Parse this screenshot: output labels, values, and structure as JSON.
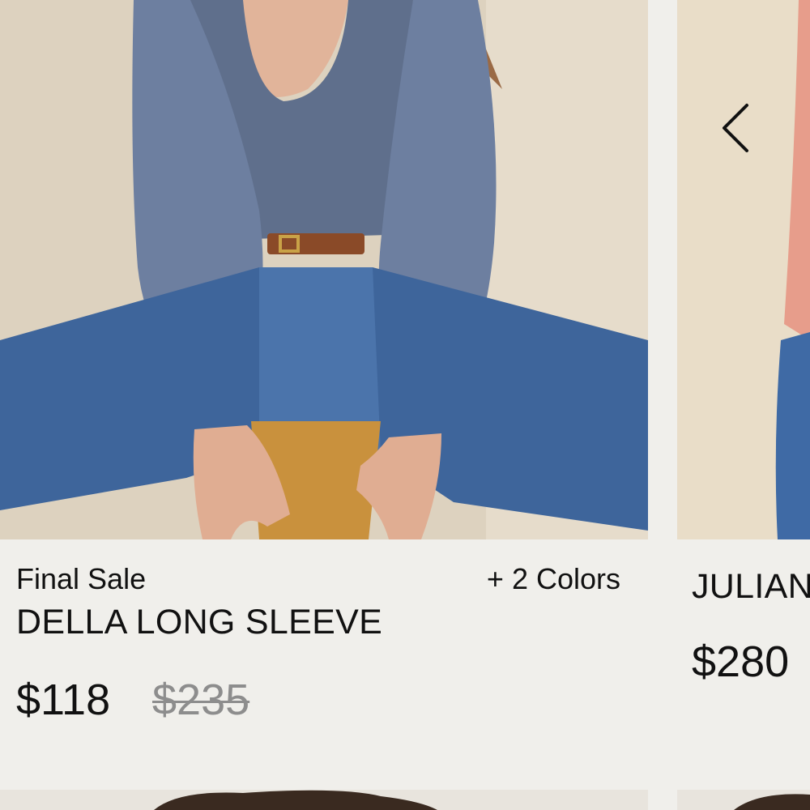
{
  "products": [
    {
      "badge": "Final Sale",
      "colors": "+ 2 Colors",
      "name": "DELLA LONG SLEEVE",
      "price": "$118",
      "original_price": "$235",
      "image": "model-photo-blue-smocked-top-jeans"
    },
    {
      "name": "JULIAN",
      "price": "$280",
      "image": "model-photo-pink-knit"
    }
  ],
  "carousel": {
    "prev_icon": "chevron-left-icon"
  },
  "colors": {
    "background": "#f0efeb",
    "text": "#111111",
    "original_price": "#8d8d8d"
  }
}
